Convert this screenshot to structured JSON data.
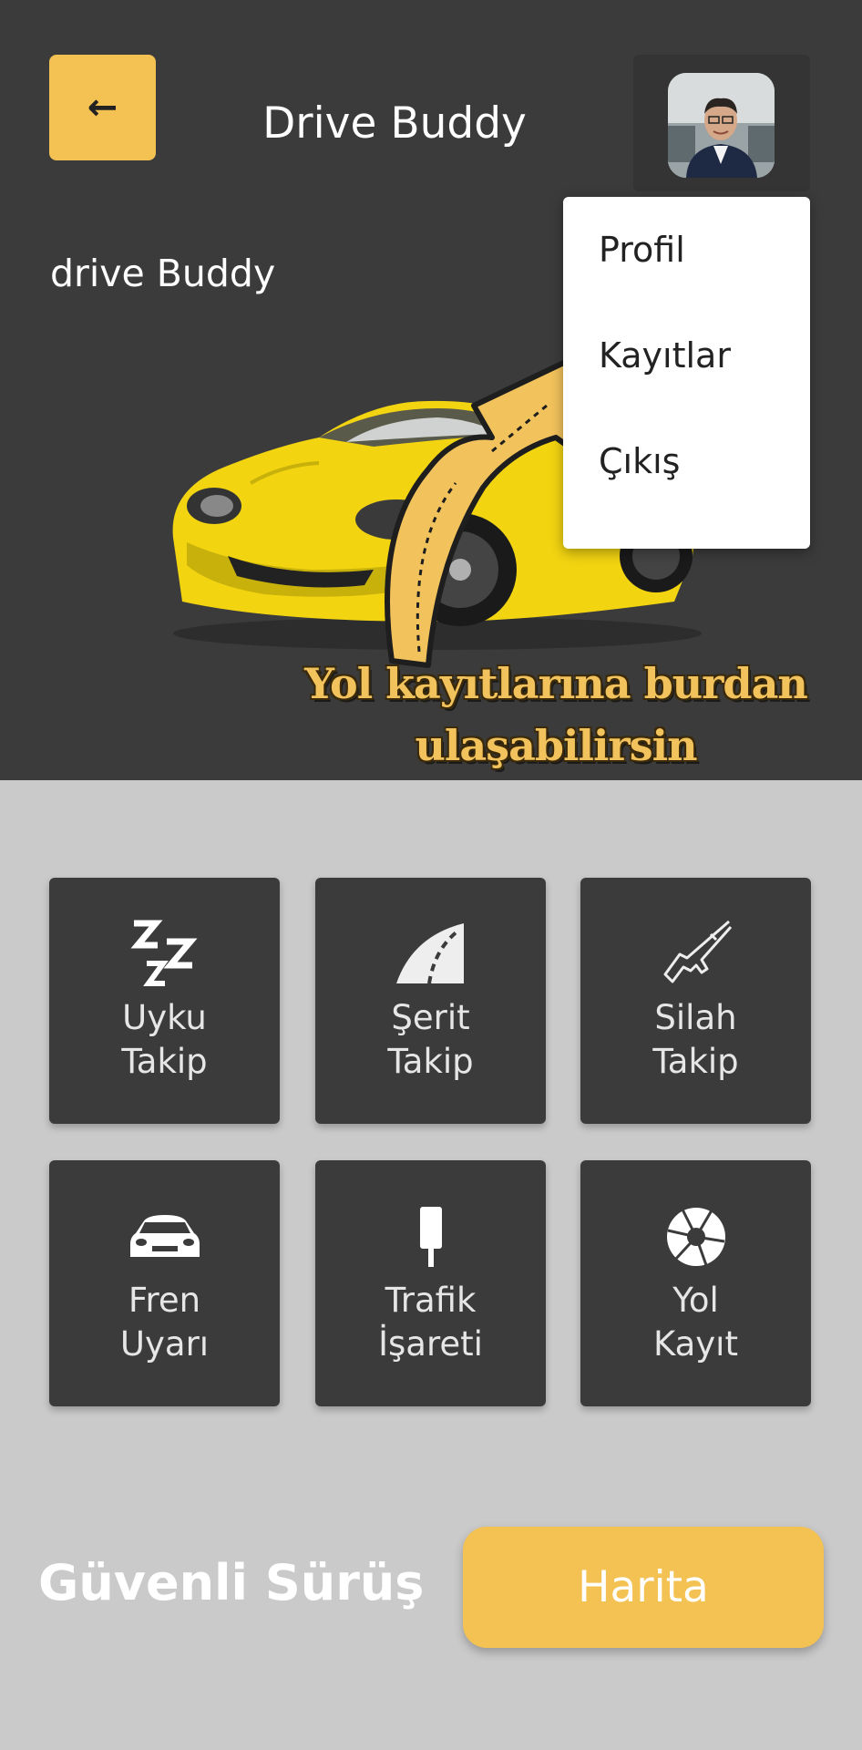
{
  "header": {
    "back_icon": "arrow-left-icon",
    "title": "Drive Buddy",
    "avatar_icon": "user-avatar"
  },
  "hero": {
    "subtitle": "drive Buddy",
    "image": "yellow-sports-car"
  },
  "profile_menu": {
    "items": [
      {
        "label": "Profil"
      },
      {
        "label": "Kayıtlar"
      },
      {
        "label": "Çıkış"
      }
    ]
  },
  "callout": {
    "line1": "Yol kayıtlarına burdan",
    "line2": "ulaşabilirsin",
    "icon": "curved-arrow-icon"
  },
  "features": [
    {
      "line1": "Uyku",
      "line2": "Takip",
      "icon": "sleep-zzz-icon"
    },
    {
      "line1": "Şerit",
      "line2": "Takip",
      "icon": "road-lane-icon"
    },
    {
      "line1": "Silah",
      "line2": "Takip",
      "icon": "rifle-icon"
    },
    {
      "line1": "Fren",
      "line2": "Uyarı",
      "icon": "car-front-icon"
    },
    {
      "line1": "Trafik",
      "line2": "İşareti",
      "icon": "traffic-sign-icon"
    },
    {
      "line1": "Yol",
      "line2": "Kayıt",
      "icon": "camera-aperture-icon"
    }
  ],
  "footer": {
    "label": "Güvenli Sürüş",
    "map_button": "Harita"
  },
  "colors": {
    "accent": "#f4c153",
    "dark": "#3b3b3b",
    "background": "#cacaca"
  }
}
